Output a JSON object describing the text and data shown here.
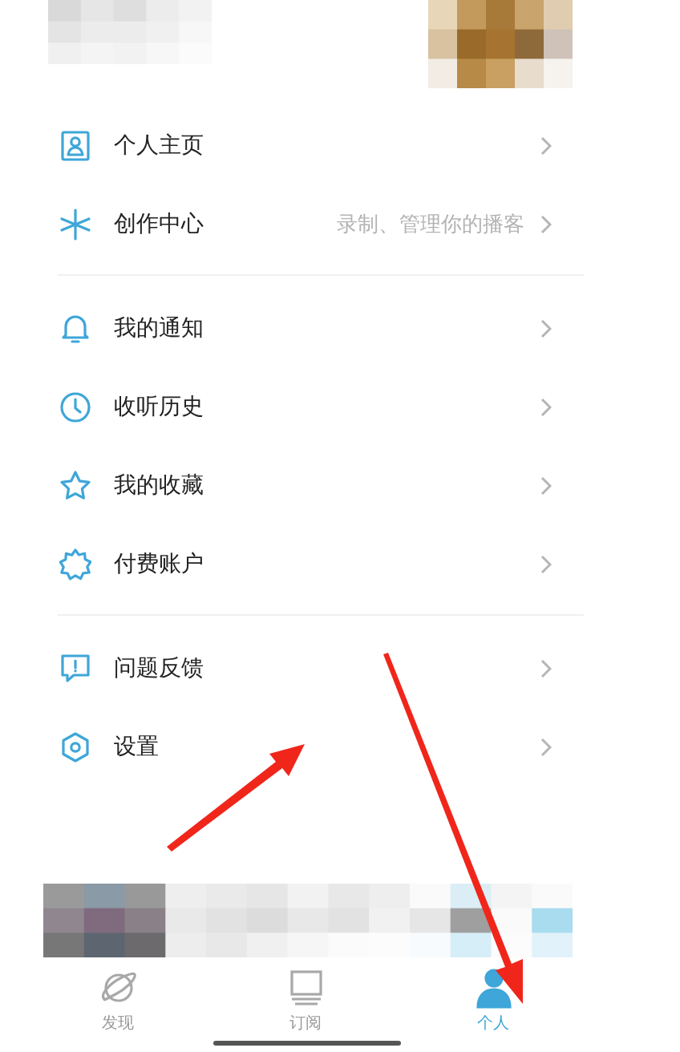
{
  "menu_sections": [
    {
      "items": [
        {
          "label": "个人主页"
        },
        {
          "label": "创作中心",
          "hint": "录制、管理你的播客"
        }
      ]
    },
    {
      "items": [
        {
          "label": "我的通知"
        },
        {
          "label": "收听历史"
        },
        {
          "label": "我的收藏"
        },
        {
          "label": "付费账户"
        }
      ]
    },
    {
      "items": [
        {
          "label": "问题反馈"
        },
        {
          "label": "设置"
        }
      ]
    }
  ],
  "tabs": [
    {
      "label": "发现",
      "selected": false
    },
    {
      "label": "订阅",
      "selected": false
    },
    {
      "label": "个人",
      "selected": true
    }
  ]
}
